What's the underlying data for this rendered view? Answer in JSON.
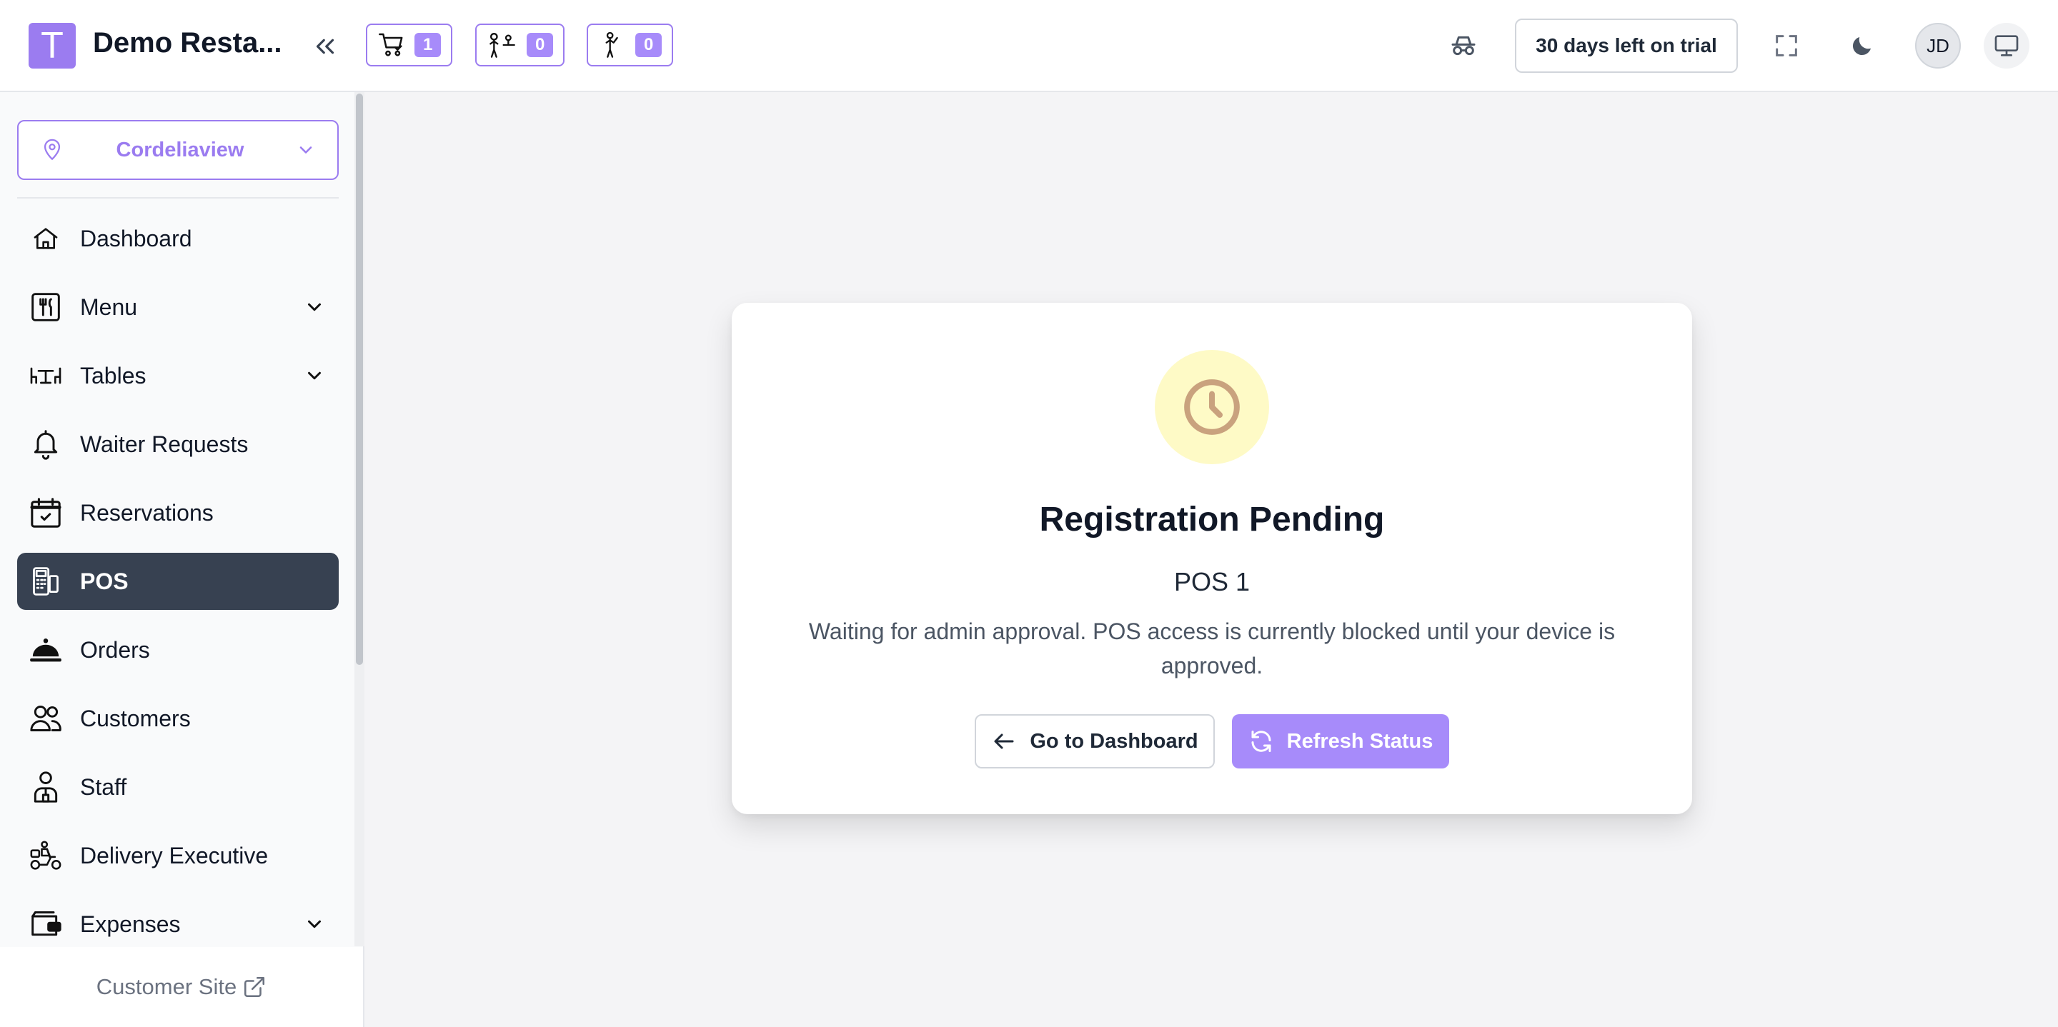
{
  "header": {
    "logo_letter": "T",
    "app_name": "Demo Resta...",
    "badges": [
      {
        "icon": "cart-icon",
        "count": "1"
      },
      {
        "icon": "waiter-service-icon",
        "count": "0"
      },
      {
        "icon": "waiter-request-icon",
        "count": "0"
      }
    ],
    "trial_text": "30 days left on trial",
    "avatar_initials": "JD"
  },
  "sidebar": {
    "location": "Cordeliaview",
    "items": [
      {
        "label": "Dashboard",
        "icon": "home-icon",
        "expandable": false,
        "active": false
      },
      {
        "label": "Menu",
        "icon": "menu-utensils-icon",
        "expandable": true,
        "active": false
      },
      {
        "label": "Tables",
        "icon": "tables-icon",
        "expandable": true,
        "active": false
      },
      {
        "label": "Waiter Requests",
        "icon": "bell-icon",
        "expandable": false,
        "active": false
      },
      {
        "label": "Reservations",
        "icon": "calendar-check-icon",
        "expandable": false,
        "active": false
      },
      {
        "label": "POS",
        "icon": "pos-terminal-icon",
        "expandable": false,
        "active": true
      },
      {
        "label": "Orders",
        "icon": "cloche-icon",
        "expandable": false,
        "active": false
      },
      {
        "label": "Customers",
        "icon": "users-icon",
        "expandable": false,
        "active": false
      },
      {
        "label": "Staff",
        "icon": "staff-icon",
        "expandable": false,
        "active": false
      },
      {
        "label": "Delivery Executive",
        "icon": "scooter-icon",
        "expandable": false,
        "active": false
      },
      {
        "label": "Expenses",
        "icon": "wallet-icon",
        "expandable": true,
        "active": false
      }
    ],
    "customer_site": "Customer Site"
  },
  "card": {
    "title": "Registration Pending",
    "subtitle": "POS 1",
    "message": "Waiting for admin approval. POS access is currently blocked until your device is approved.",
    "dashboard_button": "Go to Dashboard",
    "refresh_button": "Refresh Status"
  },
  "colors": {
    "accent": "#9b7cf0",
    "accent_fill": "#a78bfa",
    "active_nav": "#374151",
    "pending_circle": "#fefac6",
    "clock": "#c9a27e"
  }
}
